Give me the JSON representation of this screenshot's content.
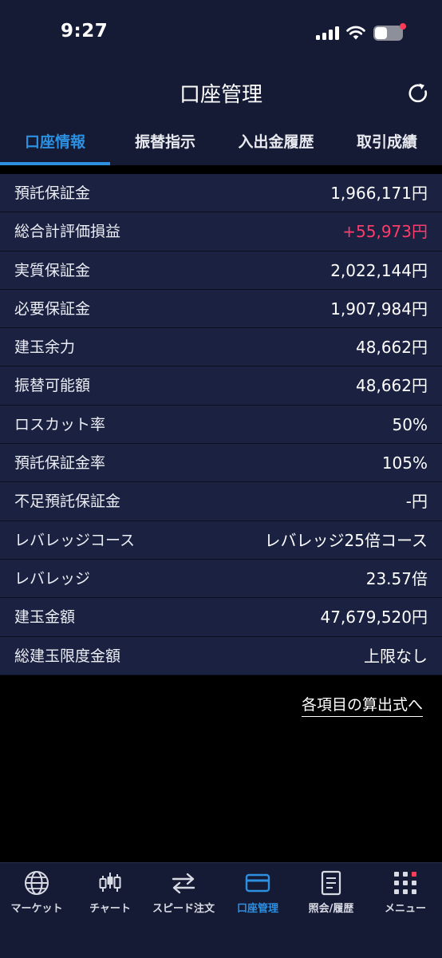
{
  "status_bar": {
    "time": "9:27",
    "battery_alert_color": "#ff3b57"
  },
  "header": {
    "title": "口座管理",
    "refresh_icon": "refresh-icon"
  },
  "tabs": [
    {
      "label": "口座情報",
      "active": true
    },
    {
      "label": "振替指示",
      "active": false
    },
    {
      "label": "入出金履歴",
      "active": false
    },
    {
      "label": "取引成績",
      "active": false
    }
  ],
  "rows": [
    {
      "label": "預託保証金",
      "value": "1,966,171円"
    },
    {
      "label": "総合計評価損益",
      "value": "+55,973円",
      "positive": true
    },
    {
      "label": "実質保証金",
      "value": "2,022,144円"
    },
    {
      "label": "必要保証金",
      "value": "1,907,984円"
    },
    {
      "label": "建玉余力",
      "value": "48,662円"
    },
    {
      "label": "振替可能額",
      "value": "48,662円"
    },
    {
      "label": "ロスカット率",
      "value": "50%"
    },
    {
      "label": "預託保証金率",
      "value": "105%"
    },
    {
      "label": "不足預託保証金",
      "value": "-円"
    },
    {
      "label": "レバレッジコース",
      "value": "レバレッジ25倍コース"
    },
    {
      "label": "レバレッジ",
      "value": "23.57倍"
    },
    {
      "label": "建玉金額",
      "value": "47,679,520円"
    },
    {
      "label": "総建玉限度金額",
      "value": "上限なし"
    }
  ],
  "formula_link": "各項目の算出式へ",
  "nav": [
    {
      "label": "マーケット",
      "icon": "globe-icon",
      "active": false
    },
    {
      "label": "チャート",
      "icon": "candlestick-icon",
      "active": false
    },
    {
      "label": "スピード注文",
      "icon": "swap-arrows-icon",
      "active": false
    },
    {
      "label": "口座管理",
      "icon": "card-icon",
      "active": true
    },
    {
      "label": "照会/履歴",
      "icon": "document-icon",
      "active": false
    },
    {
      "label": "メニュー",
      "icon": "grid-menu-icon",
      "active": false
    }
  ],
  "colors": {
    "accent": "#2d8fe0",
    "positive": "#ff3b6b",
    "header_bg": "#151b35",
    "row_bg": "#1b2140"
  }
}
